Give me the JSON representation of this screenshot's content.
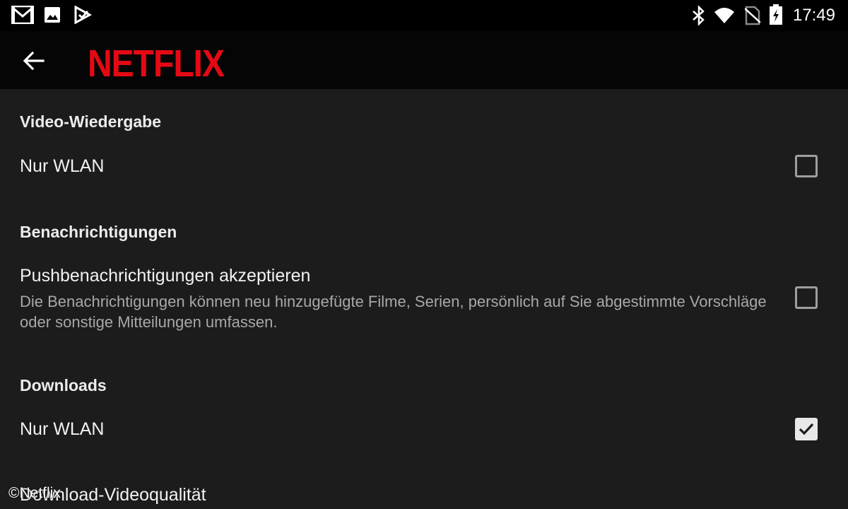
{
  "status_bar": {
    "time": "17:49",
    "left_icons": [
      "gmail-icon",
      "gallery-icon",
      "play-store-icon"
    ],
    "right_icons": [
      "bluetooth-icon",
      "wifi-icon",
      "no-sim-icon",
      "battery-charging-icon"
    ]
  },
  "app_bar": {
    "back_icon": "arrow-back-icon",
    "logo_text": "NETFLIX",
    "logo_color": "#e50914"
  },
  "settings": {
    "video": {
      "title": "Video-Wiedergabe",
      "wifi_only": {
        "label": "Nur WLAN",
        "checked": false
      }
    },
    "notifications": {
      "title": "Benachrichtigungen",
      "push": {
        "label": "Pushbenachrichtigungen akzeptieren",
        "description": "Die Benachrichtigungen können neu hinzugefügte Filme, Serien, persönlich auf Sie abgestimmte Vorschläge oder sonstige Mitteilungen umfassen.",
        "checked": false
      }
    },
    "downloads": {
      "title": "Downloads",
      "wifi_only": {
        "label": "Nur WLAN",
        "checked": true
      },
      "quality_label": "Download-Videoqualität"
    }
  },
  "watermark": "©Netflix",
  "colors": {
    "background": "#1c1c1c",
    "appbar": "#050505",
    "accent": "#e50914"
  }
}
